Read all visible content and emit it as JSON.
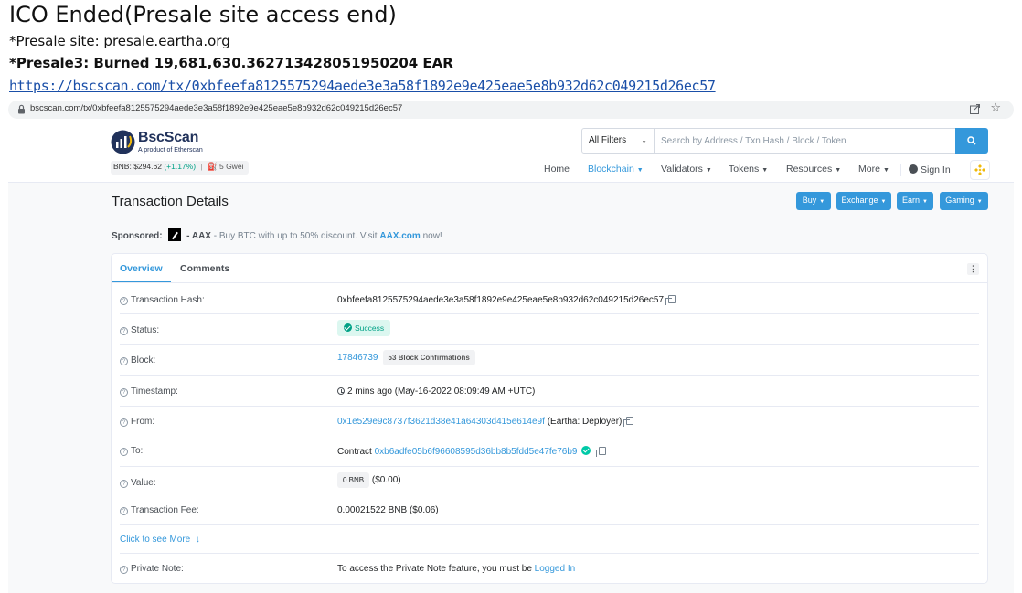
{
  "post": {
    "heading": "ICO Ended(Presale site access end)",
    "presale_note": "*Presale site: presale.eartha.org",
    "burn_line": "*Presale3: Burned 19,681,630.362713428051950204 EAR",
    "tx_link": "https://bscscan.com/tx/0xbfeefa8125575294aede3e3a58f1892e9e425eae5e8b932d62c049215d26ec57"
  },
  "browser": {
    "address": "bscscan.com/tx/0xbfeefa8125575294aede3e3a58f1892e9e425eae5e8b932d62c049215d26ec57",
    "star": "☆"
  },
  "site": {
    "logo_name": "BscScan",
    "logo_sub": "A product of Etherscan",
    "bnb_price": "BNB: $294.62",
    "bnb_change": "(+1.17%)",
    "separator": "|",
    "gas": "5 Gwei",
    "filter_label": "All Filters",
    "search_placeholder": "Search by Address / Txn Hash / Block / Token",
    "nav": {
      "home": "Home",
      "blockchain": "Blockchain",
      "validators": "Validators",
      "tokens": "Tokens",
      "resources": "Resources",
      "more": "More",
      "signin": "Sign In"
    },
    "page_title": "Transaction Details",
    "buttons": {
      "buy": "Buy",
      "exchange": "Exchange",
      "earn": "Earn",
      "gaming": "Gaming"
    },
    "sponsor": {
      "label": "Sponsored:",
      "name": "- AAX",
      "text": "- Buy BTC with up to 50% discount. Visit",
      "link": "AAX.com",
      "tail": "now!"
    },
    "tabs": {
      "overview": "Overview",
      "comments": "Comments"
    },
    "details": {
      "hash_label": "Transaction Hash:",
      "hash_value": "0xbfeefa8125575294aede3e3a58f1892e9e425eae5e8b932d62c049215d26ec57",
      "status_label": "Status:",
      "status_value": "Success",
      "block_label": "Block:",
      "block_value": "17846739",
      "block_conf": "53 Block Confirmations",
      "time_label": "Timestamp:",
      "time_value": "2 mins ago (May-16-2022 08:09:49 AM +UTC)",
      "from_label": "From:",
      "from_value": "0x1e529e9c8737f3621d38e41a64303d415e614e9f",
      "from_tag": "(Eartha: Deployer)",
      "to_label": "To:",
      "to_prefix": "Contract",
      "to_value": "0xb6adfe05b6f96608595d36bb8b5fdd5e47fe76b9",
      "value_label": "Value:",
      "value_amount": "0 BNB",
      "value_usd": "($0.00)",
      "fee_label": "Transaction Fee:",
      "fee_value": "0.00021522 BNB ($0.06)",
      "see_more": "Click to see More",
      "note_label": "Private Note:",
      "note_text": "To access the Private Note feature, you must be",
      "note_link": "Logged In"
    }
  },
  "colors": {
    "accent": "#3498db",
    "success": "#00a186",
    "navy": "#21325b",
    "bnb": "#f0b90b"
  },
  "icons": [
    "lock-icon",
    "share-icon",
    "star-icon",
    "bscscan-logo-icon",
    "search-icon",
    "user-icon",
    "bnb-logo-icon",
    "question-icon",
    "copy-icon",
    "check-icon",
    "clock-icon",
    "arrow-down-icon",
    "kebab-icon"
  ]
}
